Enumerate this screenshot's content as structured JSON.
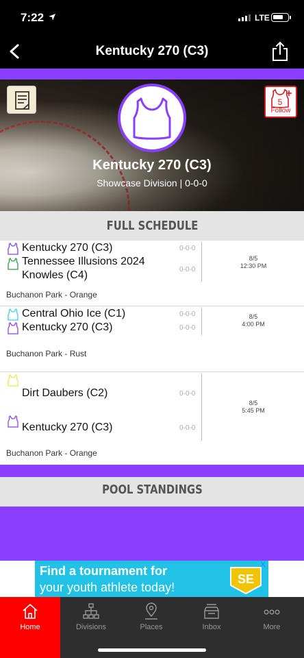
{
  "status_bar": {
    "time": "7:22",
    "network": "LTE"
  },
  "nav": {
    "title": "Kentucky 270 (C3)"
  },
  "header": {
    "team_name": "Kentucky 270 (C3)",
    "subtitle": "Showcase Division | 0-0-0",
    "follow_label": "Follow",
    "follow_badge": "5",
    "colors": {
      "accent": "#8a3ffc",
      "follow": "#d71920"
    }
  },
  "schedule": {
    "heading": "FULL SCHEDULE",
    "games": [
      {
        "teams": [
          {
            "name": "Kentucky 270 (C3)",
            "record": "0-0-0",
            "jersey_color": "#8a3ffc"
          },
          {
            "name": "Tennessee Illusions 2024 Knowles (C4)",
            "record": "0-0-0",
            "jersey_color": "#2e9e3e"
          }
        ],
        "date": "8/5",
        "time": "12:30 PM",
        "venue": "Buchanon Park - Orange"
      },
      {
        "teams": [
          {
            "name": "Central Ohio Ice (C1)",
            "record": "0-0-0",
            "jersey_color": "#3fd0e6"
          },
          {
            "name": "Kentucky 270 (C3)",
            "record": "0-0-0",
            "jersey_color": "#8a3ffc"
          }
        ],
        "date": "8/5",
        "time": "4:00 PM",
        "venue": "Buchanon Park - Rust"
      },
      {
        "teams": [
          {
            "name": "Dirt Daubers (C2)",
            "record": "0-0-0",
            "jersey_color": "#e8e85a"
          },
          {
            "name": "Kentucky 270 (C3)",
            "record": "0-0-0",
            "jersey_color": "#8a3ffc"
          }
        ],
        "date": "8/5",
        "time": "5:45 PM",
        "venue": "Buchanon Park - Orange"
      }
    ]
  },
  "pool": {
    "heading": "POOL STANDINGS"
  },
  "ad": {
    "line1": "Find a tournament for",
    "line2": "your youth athlete today!",
    "close": "X",
    "badge_text": "SE"
  },
  "tabs": [
    {
      "label": "Home",
      "icon": "home-icon",
      "active": true
    },
    {
      "label": "Divisions",
      "icon": "bracket-icon"
    },
    {
      "label": "Places",
      "icon": "location-pin-icon"
    },
    {
      "label": "Inbox",
      "icon": "inbox-icon"
    },
    {
      "label": "More",
      "icon": "more-dots-icon"
    }
  ]
}
